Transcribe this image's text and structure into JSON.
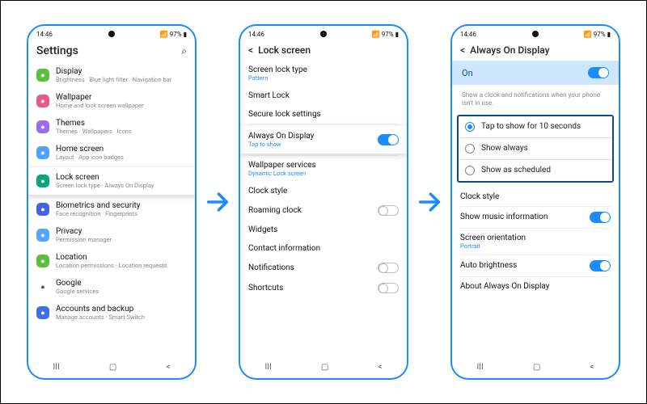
{
  "status": {
    "time": "14:46",
    "right": "97%"
  },
  "screen1": {
    "title": "Settings",
    "items": [
      {
        "label": "Display",
        "sub": "Brightness · Blue light filter · Navigation bar",
        "color": "#5bbf3b",
        "icon": "display-icon"
      },
      {
        "label": "Wallpaper",
        "sub": "Home and lock screen wallpaper",
        "color": "#e85a8a",
        "icon": "wallpaper-icon"
      },
      {
        "label": "Themes",
        "sub": "Themes · Wallpapers · Icons",
        "color": "#9c6cf0",
        "icon": "themes-icon"
      },
      {
        "label": "Home screen",
        "sub": "Layout · App icon badges",
        "color": "#4f9fff",
        "icon": "home-icon"
      },
      {
        "label": "Lock screen",
        "sub": "Screen lock type · Always On Display",
        "color": "#0aa77a",
        "icon": "lock-icon",
        "elevated": true
      },
      {
        "label": "Biometrics and security",
        "sub": "Face recognition · Fingerprints",
        "color": "#4264e8",
        "icon": "biometrics-icon"
      },
      {
        "label": "Privacy",
        "sub": "Permission manager",
        "color": "#4fa7ff",
        "icon": "privacy-icon"
      },
      {
        "label": "Location",
        "sub": "Location permissions · Location requests",
        "color": "#5bbf3b",
        "icon": "location-icon"
      },
      {
        "label": "Google",
        "sub": "Google services",
        "color": "#ffffff",
        "icon": "google-icon",
        "fg": "#555"
      },
      {
        "label": "Accounts and backup",
        "sub": "Manage accounts · Smart Switch",
        "color": "#3d6df0",
        "icon": "accounts-icon"
      }
    ]
  },
  "screen2": {
    "title": "Lock screen",
    "rows": [
      {
        "label": "Screen lock type",
        "sub": "Pattern",
        "subBlue": true
      },
      {
        "label": "Smart Lock"
      },
      {
        "label": "Secure lock settings"
      },
      {
        "label": "Always On Display",
        "sub": "Tap to show",
        "subBlue": true,
        "toggle": "on",
        "elevated": true
      },
      {
        "label": "Wallpaper services",
        "sub": "Dynamic Lock screen",
        "subBlue": true
      },
      {
        "label": "Clock style"
      },
      {
        "label": "Roaming clock",
        "toggle": "off"
      },
      {
        "label": "Widgets"
      },
      {
        "label": "Contact information"
      },
      {
        "label": "Notifications",
        "toggle": "off"
      },
      {
        "label": "Shortcuts",
        "toggle": "off"
      }
    ]
  },
  "screen3": {
    "title": "Always On Display",
    "onLabel": "On",
    "hint": "Show a clock and notifications when your phone isn't in use.",
    "radios": [
      {
        "label": "Tap to show for 10 seconds",
        "selected": true
      },
      {
        "label": "Show always",
        "selected": false
      },
      {
        "label": "Show as scheduled",
        "selected": false
      }
    ],
    "rows": [
      {
        "label": "Clock style"
      },
      {
        "label": "Show music information",
        "toggle": "on"
      },
      {
        "label": "Screen orientation",
        "sub": "Portrait",
        "subBlue": true
      },
      {
        "label": "Auto brightness",
        "toggle": "on"
      },
      {
        "label": "About Always On Display"
      }
    ]
  },
  "nav": {
    "recents": "|||",
    "home": "○",
    "back": "<"
  }
}
